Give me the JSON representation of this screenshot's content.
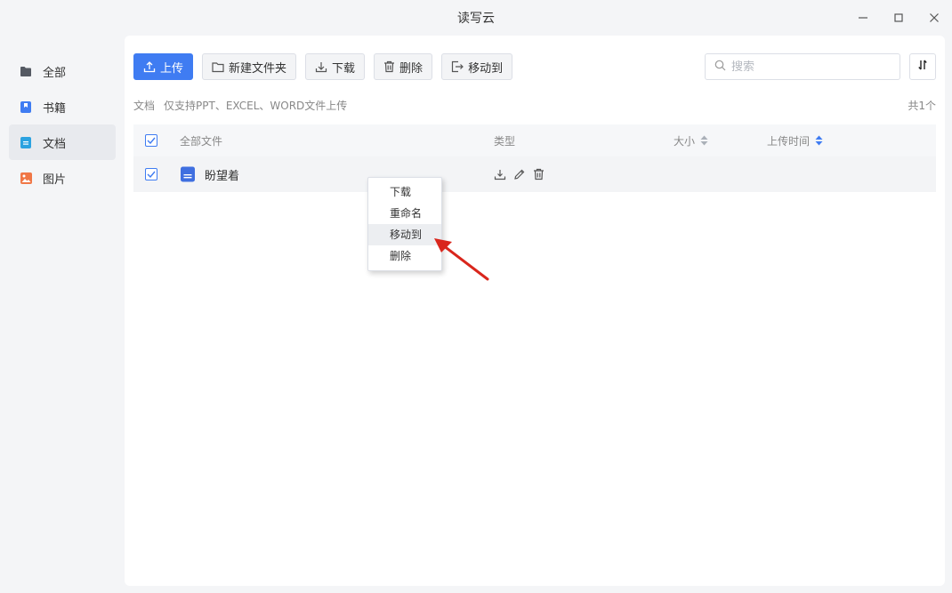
{
  "window": {
    "title": "读写云"
  },
  "sidebar": {
    "items": [
      {
        "label": "全部",
        "icon": "folder-icon",
        "color": "#555a63"
      },
      {
        "label": "书籍",
        "icon": "bookmark-book-icon",
        "color": "#3f7cf2"
      },
      {
        "label": "文档",
        "icon": "document-icon",
        "color": "#2ba2e0"
      },
      {
        "label": "图片",
        "icon": "image-icon",
        "color": "#f07746"
      }
    ],
    "active": "文档"
  },
  "toolbar": {
    "upload": "上传",
    "new_folder": "新建文件夹",
    "download": "下载",
    "delete": "删除",
    "move_to": "移动到"
  },
  "search": {
    "placeholder": "搜索"
  },
  "info": {
    "category": "文档",
    "note": "仅支持PPT、EXCEL、WORD文件上传",
    "count": "共1个"
  },
  "table": {
    "columns": {
      "name": "全部文件",
      "type": "类型",
      "size": "大小",
      "time": "上传时间"
    },
    "rows": [
      {
        "name": "盼望着",
        "checked": true
      }
    ]
  },
  "context_menu": {
    "items": [
      "下载",
      "重命名",
      "移动到",
      "删除"
    ],
    "highlighted": "移动到"
  },
  "colors": {
    "accent": "#3f7cf2",
    "arrow": "#d9261c"
  }
}
